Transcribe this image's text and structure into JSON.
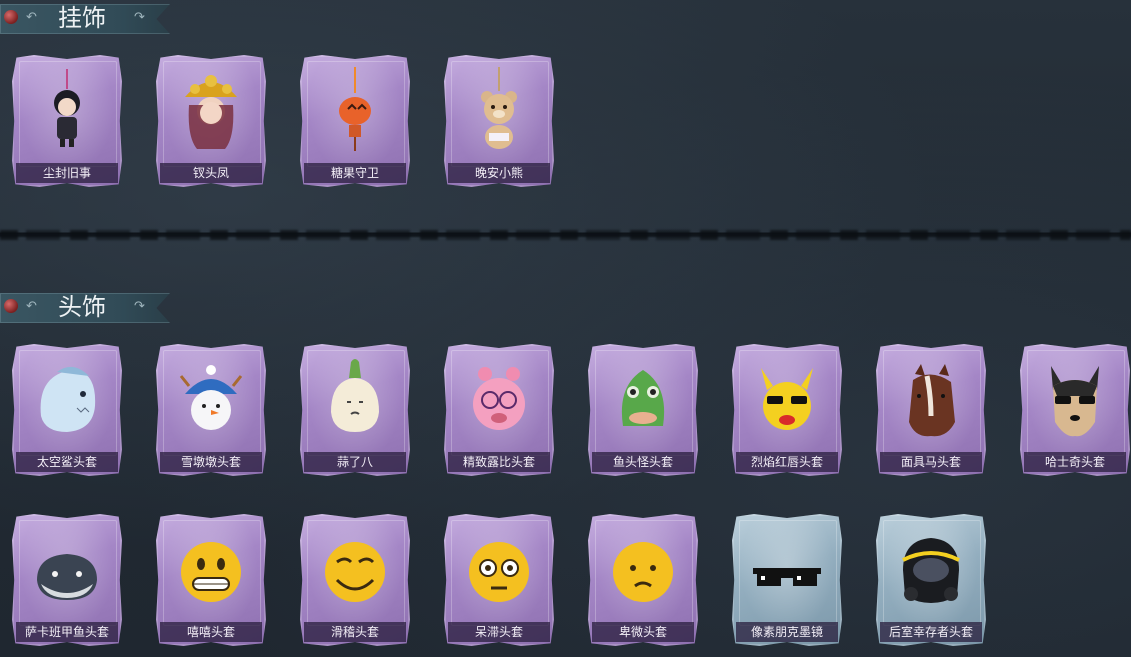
{
  "sections": [
    {
      "title": "挂饰"
    },
    {
      "title": "头饰"
    }
  ],
  "pendants": [
    {
      "label": "尘封旧事",
      "icon": "chibi-boy-pendant-icon"
    },
    {
      "label": "钗头凤",
      "icon": "phoenix-crown-pendant-icon"
    },
    {
      "label": "糖果守卫",
      "icon": "pumpkin-candy-pendant-icon"
    },
    {
      "label": "晚安小熊",
      "icon": "teddy-bear-pendant-icon"
    }
  ],
  "headwear_row1": [
    {
      "label": "太空鲨头套",
      "icon": "shark-head-icon"
    },
    {
      "label": "雪墩墩头套",
      "icon": "snowman-head-icon"
    },
    {
      "label": "蒜了八",
      "icon": "garlic-head-icon"
    },
    {
      "label": "精致露比头套",
      "icon": "pink-creature-head-icon"
    },
    {
      "label": "鱼头怪头套",
      "icon": "fish-mask-icon"
    },
    {
      "label": "烈焰红唇头套",
      "icon": "yellow-pikachu-mask-icon"
    },
    {
      "label": "面具马头套",
      "icon": "horse-mask-icon"
    },
    {
      "label": "哈士奇头套",
      "icon": "husky-mask-icon"
    }
  ],
  "headwear_row2": [
    {
      "label": "萨卡班甲鱼头套",
      "icon": "fish-whale-head-icon"
    },
    {
      "label": "嘻嘻头套",
      "icon": "grin-emoji-head-icon"
    },
    {
      "label": "滑稽头套",
      "icon": "funny-emoji-head-icon"
    },
    {
      "label": "呆滞头套",
      "icon": "dazed-emoji-head-icon"
    },
    {
      "label": "卑微头套",
      "icon": "humble-emoji-head-icon"
    },
    {
      "label": "像素朋克墨镜",
      "icon": "pixel-sunglasses-icon"
    },
    {
      "label": "后室幸存者头套",
      "icon": "gas-mask-helmet-icon"
    }
  ],
  "colors": {
    "card_purple": "#a486c6",
    "card_blue": "#93aebf",
    "background": "#232c35",
    "title_text": "#eef2f4"
  }
}
